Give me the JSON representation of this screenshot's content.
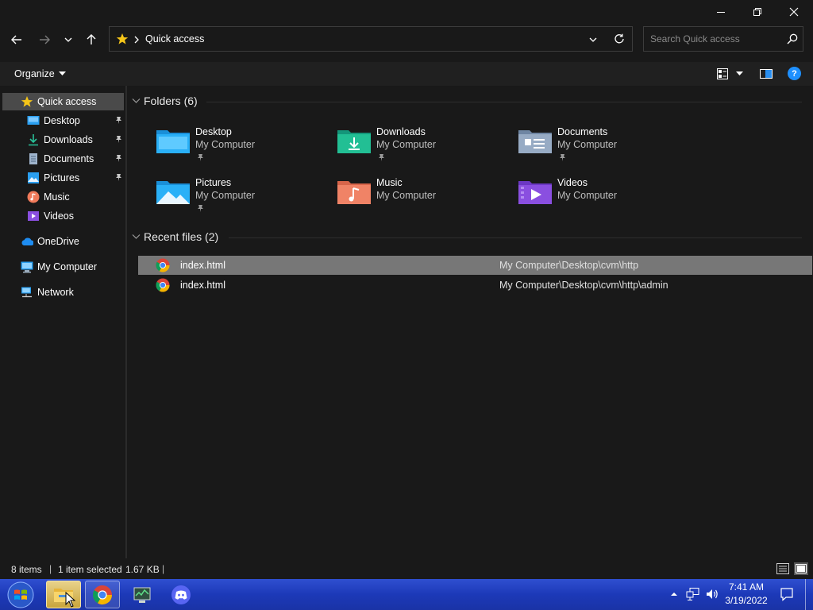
{
  "window": {
    "minimize_icon": "minimize-icon",
    "maximize_icon": "restore-icon",
    "close_icon": "close-icon"
  },
  "address": {
    "location_icon": "star-icon",
    "path": "Quick access",
    "search_placeholder": "Search Quick access"
  },
  "commandbar": {
    "organize_label": "Organize",
    "help_label": "?"
  },
  "navpane": {
    "items": [
      {
        "label": "Quick access",
        "icon": "star-icon"
      },
      {
        "label": "Desktop",
        "icon": "desktop-icon",
        "pinned": true
      },
      {
        "label": "Downloads",
        "icon": "download-icon",
        "pinned": true
      },
      {
        "label": "Documents",
        "icon": "documents-icon",
        "pinned": true
      },
      {
        "label": "Pictures",
        "icon": "pictures-icon",
        "pinned": true
      },
      {
        "label": "Music",
        "icon": "music-icon"
      },
      {
        "label": "Videos",
        "icon": "videos-icon"
      },
      {
        "label": "OneDrive",
        "icon": "cloud-icon"
      },
      {
        "label": "My Computer",
        "icon": "computer-icon"
      },
      {
        "label": "Network",
        "icon": "network-icon"
      }
    ]
  },
  "content": {
    "folders_header": "Folders (6)",
    "folders": [
      {
        "name": "Desktop",
        "location": "My Computer",
        "pinned": true,
        "color": "#1ea7f5"
      },
      {
        "name": "Downloads",
        "location": "My Computer",
        "pinned": true,
        "color": "#1fb58f"
      },
      {
        "name": "Documents",
        "location": "My Computer",
        "pinned": true,
        "color": "#8aa3c0"
      },
      {
        "name": "Pictures",
        "location": "My Computer",
        "pinned": true,
        "color": "#2aa8f0"
      },
      {
        "name": "Music",
        "location": "My Computer",
        "pinned": false,
        "color": "#ef7f5f"
      },
      {
        "name": "Videos",
        "location": "My Computer",
        "pinned": false,
        "color": "#8a4fe0"
      }
    ],
    "recent_header": "Recent files (2)",
    "recent_files": [
      {
        "name": "index.html",
        "path": "My Computer\\Desktop\\cvm\\http",
        "selected": true
      },
      {
        "name": "index.html",
        "path": "My Computer\\Desktop\\cvm\\http\\admin",
        "selected": false
      }
    ]
  },
  "status": {
    "items_count": "8 items",
    "selection": "1 item selected",
    "size": "1.67 KB"
  },
  "taskbar": {
    "time": "7:41 AM",
    "date": "3/19/2022",
    "accent": "#1c39b8"
  }
}
